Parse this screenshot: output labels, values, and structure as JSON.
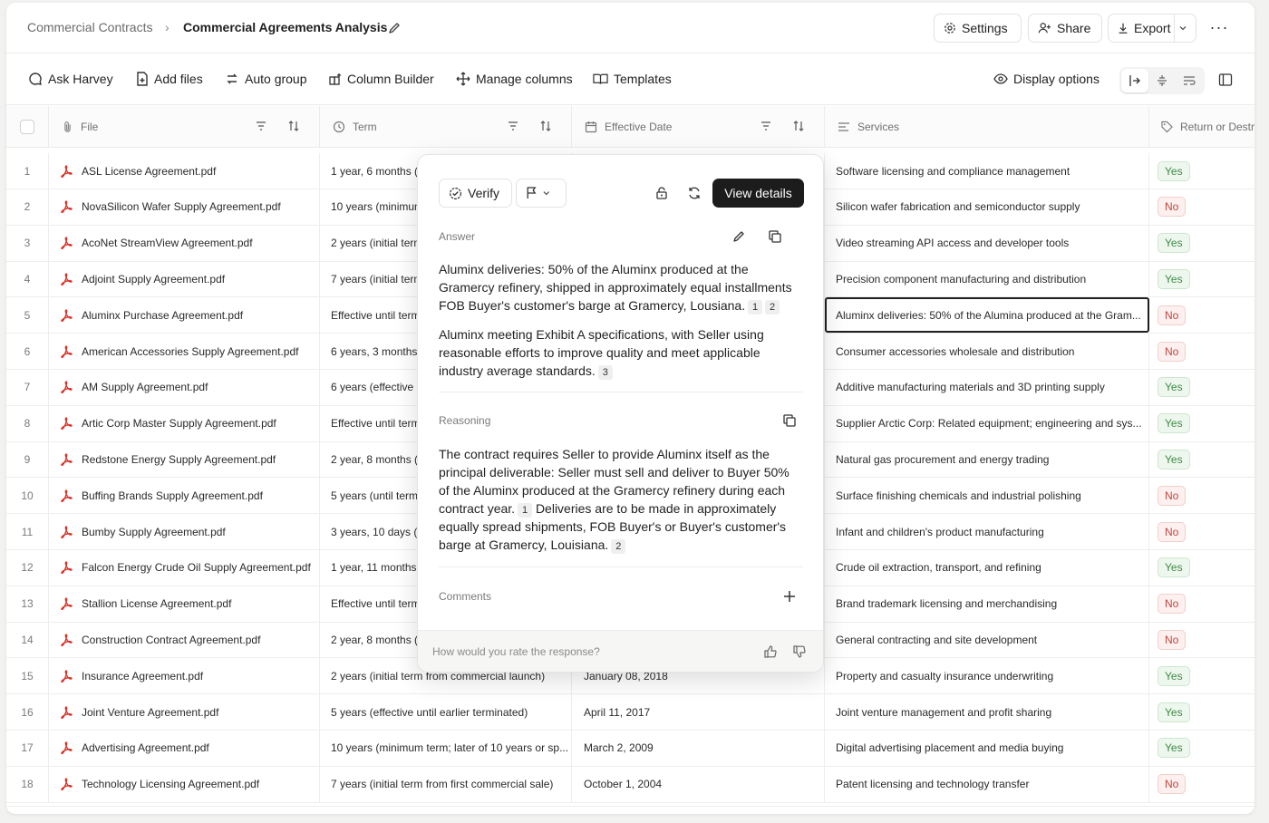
{
  "breadcrumb": {
    "root": "Commercial Contracts",
    "separator": "›",
    "current": "Commercial Agreements Analysis"
  },
  "top_actions": {
    "settings": "Settings",
    "share": "Share",
    "export": "Export",
    "more": "···"
  },
  "toolbar": {
    "ask": "Ask Harvey",
    "add_files": "Add files",
    "auto_group": "Auto group",
    "column_builder": "Column Builder",
    "manage_columns": "Manage columns",
    "templates": "Templates",
    "display_options": "Display options"
  },
  "columns": {
    "file": "File",
    "term": "Term",
    "effective_date": "Effective Date",
    "services": "Services",
    "return": "Return or Destr"
  },
  "rows": [
    {
      "n": "1",
      "file": "ASL License Agreement.pdf",
      "term": "1 year,  6 months (i",
      "date": "",
      "services": "Software licensing and compliance management",
      "ret": "Yes"
    },
    {
      "n": "2",
      "file": "NovaSilicon Wafer Supply Agreement.pdf",
      "term": "10 years (minimum",
      "date": "",
      "services": "Silicon wafer fabrication and semiconductor supply",
      "ret": "No"
    },
    {
      "n": "3",
      "file": "AcoNet StreamView  Agreement.pdf",
      "term": "2 years (initial term",
      "date": "",
      "services": "Video streaming API access and developer tools",
      "ret": "Yes"
    },
    {
      "n": "4",
      "file": "Adjoint Supply Agreement.pdf",
      "term": "7 years (initial term",
      "date": "",
      "services": "Precision component manufacturing and distribution",
      "ret": "Yes"
    },
    {
      "n": "5",
      "file": "Aluminx Purchase Agreement.pdf",
      "term": "Effective until term",
      "date": "",
      "services": "Aluminx deliveries: 50% of the Alumina produced at the Gram...",
      "ret": "No"
    },
    {
      "n": "6",
      "file": "American Accessories Supply Agreement.pdf",
      "term": "6 years, 3 months",
      "date": "",
      "services": "Consumer accessories wholesale and distribution",
      "ret": "No"
    },
    {
      "n": "7",
      "file": "AM Supply Agreement.pdf",
      "term": "6 years (effective u",
      "date": "",
      "services": "Additive manufacturing materials and 3D printing supply",
      "ret": "Yes"
    },
    {
      "n": "8",
      "file": "Artic Corp Master Supply Agreement.pdf",
      "term": "Effective until term",
      "date": "",
      "services": "Supplier Arctic Corp: Related equipment; engineering and sys...",
      "ret": "Yes"
    },
    {
      "n": "9",
      "file": "Redstone Energy Supply Agreement.pdf",
      "term": "2 year,  8 months (",
      "date": "",
      "services": "Natural gas procurement and energy trading",
      "ret": "Yes"
    },
    {
      "n": "10",
      "file": "Buffing Brands Supply Agreement.pdf",
      "term": "5 years (until termi",
      "date": "",
      "services": "Surface finishing chemicals and industrial polishing",
      "ret": "No"
    },
    {
      "n": "11",
      "file": "Bumby Supply Agreement.pdf",
      "term": "3 years, 10 days (te",
      "date": "",
      "services": "Infant and children's product manufacturing",
      "ret": "No"
    },
    {
      "n": "12",
      "file": "Falcon Energy Crude Oil Supply Agreement.pdf",
      "term": "1 year, 11 months, 3",
      "date": "",
      "services": "Crude oil extraction, transport, and refining",
      "ret": "Yes"
    },
    {
      "n": "13",
      "file": "Stallion License Agreement.pdf",
      "term": "Effective until term",
      "date": "",
      "services": "Brand trademark licensing and merchandising",
      "ret": "No"
    },
    {
      "n": "14",
      "file": "Construction Contract Agreement.pdf",
      "term": "2 year,  8 months (",
      "date": "",
      "services": "General contracting and site development",
      "ret": "No"
    },
    {
      "n": "15",
      "file": "Insurance Agreement.pdf",
      "term": "2 years (initial term from commercial launch)",
      "date": "January 08, 2018",
      "services": "Property and casualty insurance underwriting",
      "ret": "Yes"
    },
    {
      "n": "16",
      "file": "Joint Venture Agreement.pdf",
      "term": "5 years (effective until earlier terminated)",
      "date": "April 11, 2017",
      "services": "Joint venture management and profit sharing",
      "ret": "Yes"
    },
    {
      "n": "17",
      "file": "Advertising Agreement.pdf",
      "term": "10 years (minimum term; later of 10 years or sp...",
      "date": "March 2, 2009",
      "services": "Digital advertising placement and media buying",
      "ret": "Yes"
    },
    {
      "n": "18",
      "file": "Technology Licensing Agreement.pdf",
      "term": "7 years (initial term from first commercial sale)",
      "date": "October 1, 2004",
      "services": "Patent licensing and technology transfer",
      "ret": "No"
    }
  ],
  "popover": {
    "verify": "Verify",
    "view_details": "View details",
    "answer_label": "Answer",
    "answer_p1": "Aluminx deliveries: 50% of the Aluminx produced at the Gramercy refinery, shipped in approximately equal installments FOB Buyer's customer's barge at Gramercy, Lousiana.",
    "answer_p1_cites": [
      "1",
      "2"
    ],
    "answer_p2": "Aluminx meeting Exhibit A specifications, with Seller using reasonable efforts to improve quality and meet applicable industry average standards.",
    "answer_p2_cites": [
      "3"
    ],
    "reasoning_label": "Reasoning",
    "reasoning_a": "The contract requires Seller to provide Aluminx itself as the principal deliverable: Seller must sell and deliver to Buyer 50% of the Aluminx produced at the Gramercy refinery during each contract year.",
    "reasoning_cite1": "1",
    "reasoning_b": "Deliveries are to be made in approximately equally spread shipments, FOB Buyer's or Buyer's customer's barge at Gramercy, Louisiana.",
    "reasoning_cite2": "2",
    "comments_label": "Comments",
    "rate_prompt": "How would you rate the response?"
  }
}
